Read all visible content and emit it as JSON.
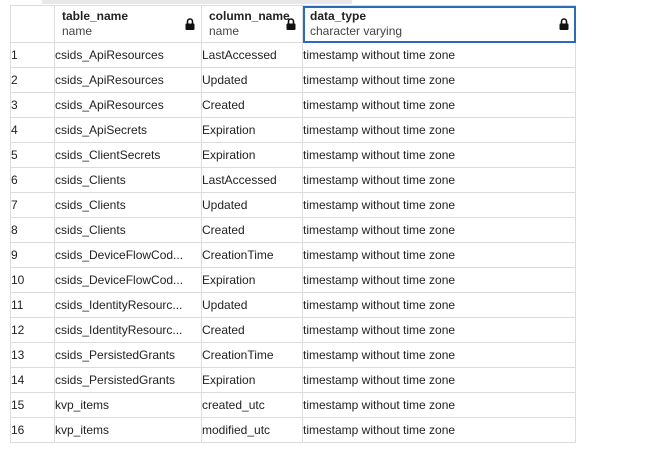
{
  "columns": [
    {
      "name": "",
      "type": ""
    },
    {
      "name": "table_name",
      "type": "name"
    },
    {
      "name": "column_name",
      "type": "name"
    },
    {
      "name": "data_type",
      "type": "character varying"
    }
  ],
  "rows": [
    {
      "n": "1",
      "table_name": "csids_ApiResources",
      "column_name": "LastAccessed",
      "data_type": "timestamp without time zone"
    },
    {
      "n": "2",
      "table_name": "csids_ApiResources",
      "column_name": "Updated",
      "data_type": "timestamp without time zone"
    },
    {
      "n": "3",
      "table_name": "csids_ApiResources",
      "column_name": "Created",
      "data_type": "timestamp without time zone"
    },
    {
      "n": "4",
      "table_name": "csids_ApiSecrets",
      "column_name": "Expiration",
      "data_type": "timestamp without time zone"
    },
    {
      "n": "5",
      "table_name": "csids_ClientSecrets",
      "column_name": "Expiration",
      "data_type": "timestamp without time zone"
    },
    {
      "n": "6",
      "table_name": "csids_Clients",
      "column_name": "LastAccessed",
      "data_type": "timestamp without time zone"
    },
    {
      "n": "7",
      "table_name": "csids_Clients",
      "column_name": "Updated",
      "data_type": "timestamp without time zone"
    },
    {
      "n": "8",
      "table_name": "csids_Clients",
      "column_name": "Created",
      "data_type": "timestamp without time zone"
    },
    {
      "n": "9",
      "table_name": "csids_DeviceFlowCod...",
      "column_name": "CreationTime",
      "data_type": "timestamp without time zone"
    },
    {
      "n": "10",
      "table_name": "csids_DeviceFlowCod...",
      "column_name": "Expiration",
      "data_type": "timestamp without time zone"
    },
    {
      "n": "11",
      "table_name": "csids_IdentityResourc...",
      "column_name": "Updated",
      "data_type": "timestamp without time zone"
    },
    {
      "n": "12",
      "table_name": "csids_IdentityResourc...",
      "column_name": "Created",
      "data_type": "timestamp without time zone"
    },
    {
      "n": "13",
      "table_name": "csids_PersistedGrants",
      "column_name": "CreationTime",
      "data_type": "timestamp without time zone"
    },
    {
      "n": "14",
      "table_name": "csids_PersistedGrants",
      "column_name": "Expiration",
      "data_type": "timestamp without time zone"
    },
    {
      "n": "15",
      "table_name": "kvp_items",
      "column_name": "created_utc",
      "data_type": "timestamp without time zone"
    },
    {
      "n": "16",
      "table_name": "kvp_items",
      "column_name": "modified_utc",
      "data_type": "timestamp without time zone"
    }
  ],
  "icons": {
    "column_lock": "lock-icon"
  },
  "colors": {
    "selected_header_border": "#2c6bb5",
    "grid_line": "#dcdcdc"
  }
}
